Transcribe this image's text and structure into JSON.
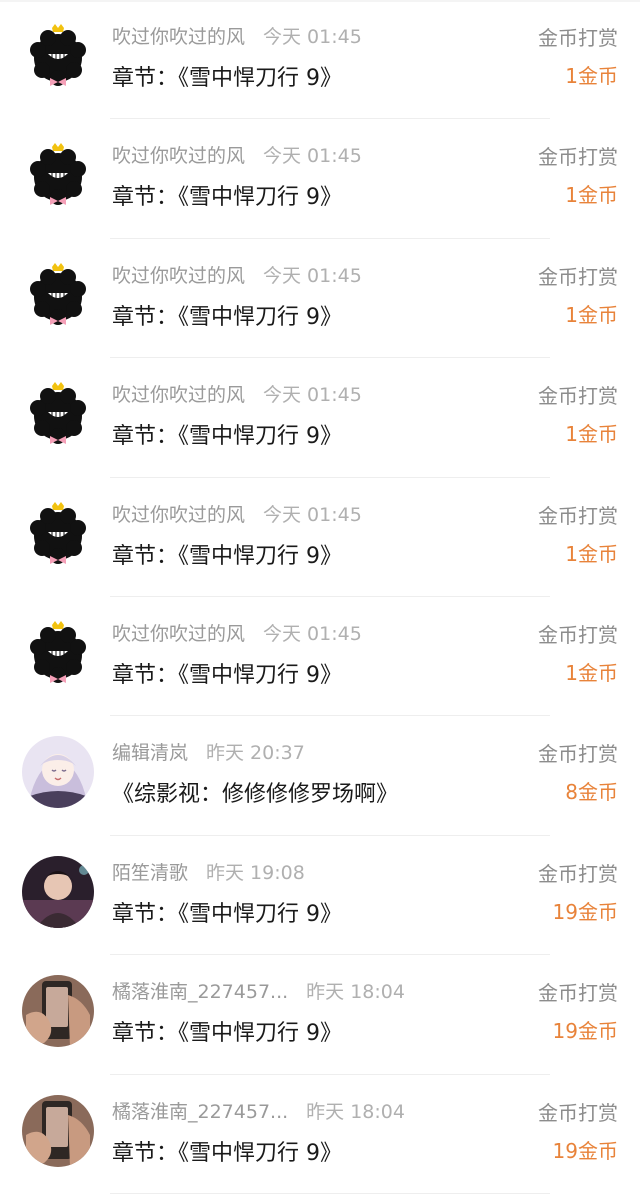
{
  "records": [
    {
      "user": "吹过你吹过的风",
      "time": "今天 01:45",
      "prefix": "章节：",
      "book": "《雪中悍刀行 9》",
      "type": "金币打赏",
      "amount": "1金币",
      "avatar": "black-fluffy-avatar-icon"
    },
    {
      "user": "吹过你吹过的风",
      "time": "今天 01:45",
      "prefix": "章节：",
      "book": "《雪中悍刀行 9》",
      "type": "金币打赏",
      "amount": "1金币",
      "avatar": "black-fluffy-avatar-icon"
    },
    {
      "user": "吹过你吹过的风",
      "time": "今天 01:45",
      "prefix": "章节：",
      "book": "《雪中悍刀行 9》",
      "type": "金币打赏",
      "amount": "1金币",
      "avatar": "black-fluffy-avatar-icon"
    },
    {
      "user": "吹过你吹过的风",
      "time": "今天 01:45",
      "prefix": "章节：",
      "book": "《雪中悍刀行 9》",
      "type": "金币打赏",
      "amount": "1金币",
      "avatar": "black-fluffy-avatar-icon"
    },
    {
      "user": "吹过你吹过的风",
      "time": "今天 01:45",
      "prefix": "章节：",
      "book": "《雪中悍刀行 9》",
      "type": "金币打赏",
      "amount": "1金币",
      "avatar": "black-fluffy-avatar-icon"
    },
    {
      "user": "吹过你吹过的风",
      "time": "今天 01:45",
      "prefix": "章节：",
      "book": "《雪中悍刀行 9》",
      "type": "金币打赏",
      "amount": "1金币",
      "avatar": "black-fluffy-avatar-icon"
    },
    {
      "user": "编辑清岚",
      "time": "昨天 20:37",
      "prefix": "",
      "book": "《综影视：修修修修罗场啊》",
      "type": "金币打赏",
      "amount": "8金币",
      "avatar": "anime-girl-avatar-icon"
    },
    {
      "user": "陌笙清歌",
      "time": "昨天 19:08",
      "prefix": "章节：",
      "book": "《雪中悍刀行 9》",
      "type": "金币打赏",
      "amount": "19金币",
      "avatar": "person-photo-avatar-icon"
    },
    {
      "user": "橘落淮南_227457...",
      "time": "昨天 18:04",
      "prefix": "章节：",
      "book": "《雪中悍刀行 9》",
      "type": "金币打赏",
      "amount": "19金币",
      "avatar": "hand-photo-avatar-icon"
    },
    {
      "user": "橘落淮南_227457...",
      "time": "昨天 18:04",
      "prefix": "章节：",
      "book": "《雪中悍刀行 9》",
      "type": "金币打赏",
      "amount": "19金币",
      "avatar": "hand-photo-avatar-icon"
    }
  ],
  "colors": {
    "amount": "#e8833a",
    "meta": "#9a9a9a",
    "title": "#1a1a1a"
  }
}
